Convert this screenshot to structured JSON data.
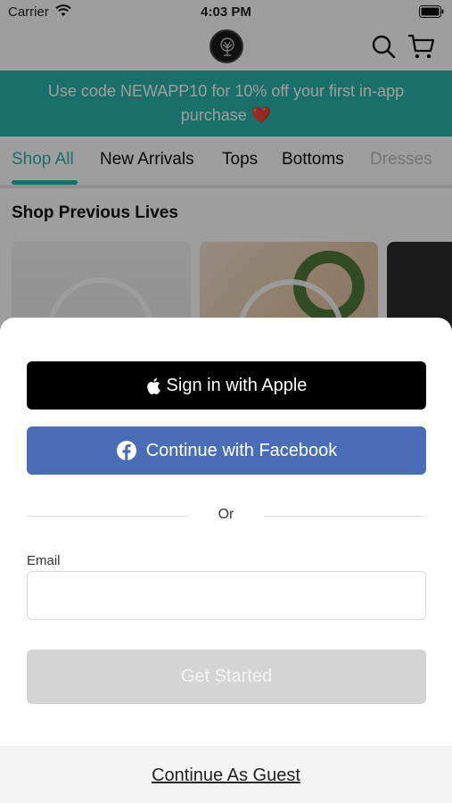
{
  "status_bar": {
    "carrier": "Carrier",
    "time": "4:03 PM"
  },
  "nav": {
    "logo_icon": "tree-logo",
    "search_icon": "search-icon",
    "cart_icon": "cart-icon"
  },
  "promo": {
    "text": "Use code NEWAPP10 for 10% off your first in-app purchase",
    "emoji": "❤️"
  },
  "tabs": [
    {
      "label": "Shop All",
      "active": true
    },
    {
      "label": "New Arrivals"
    },
    {
      "label": "Tops"
    },
    {
      "label": "Bottoms"
    },
    {
      "label": "Dresses"
    }
  ],
  "section": {
    "title": "Shop Previous Lives"
  },
  "sheet": {
    "apple_label": "Sign in with Apple",
    "facebook_label": "Continue with Facebook",
    "divider_text": "Or",
    "email_label": "Email",
    "email_value": "",
    "get_started_label": "Get Started",
    "guest_label": "Continue As Guest"
  },
  "colors": {
    "accent": "#2db3ad",
    "facebook": "#4a6eb5",
    "apple": "#000000",
    "disabled": "#d4d4d4"
  }
}
